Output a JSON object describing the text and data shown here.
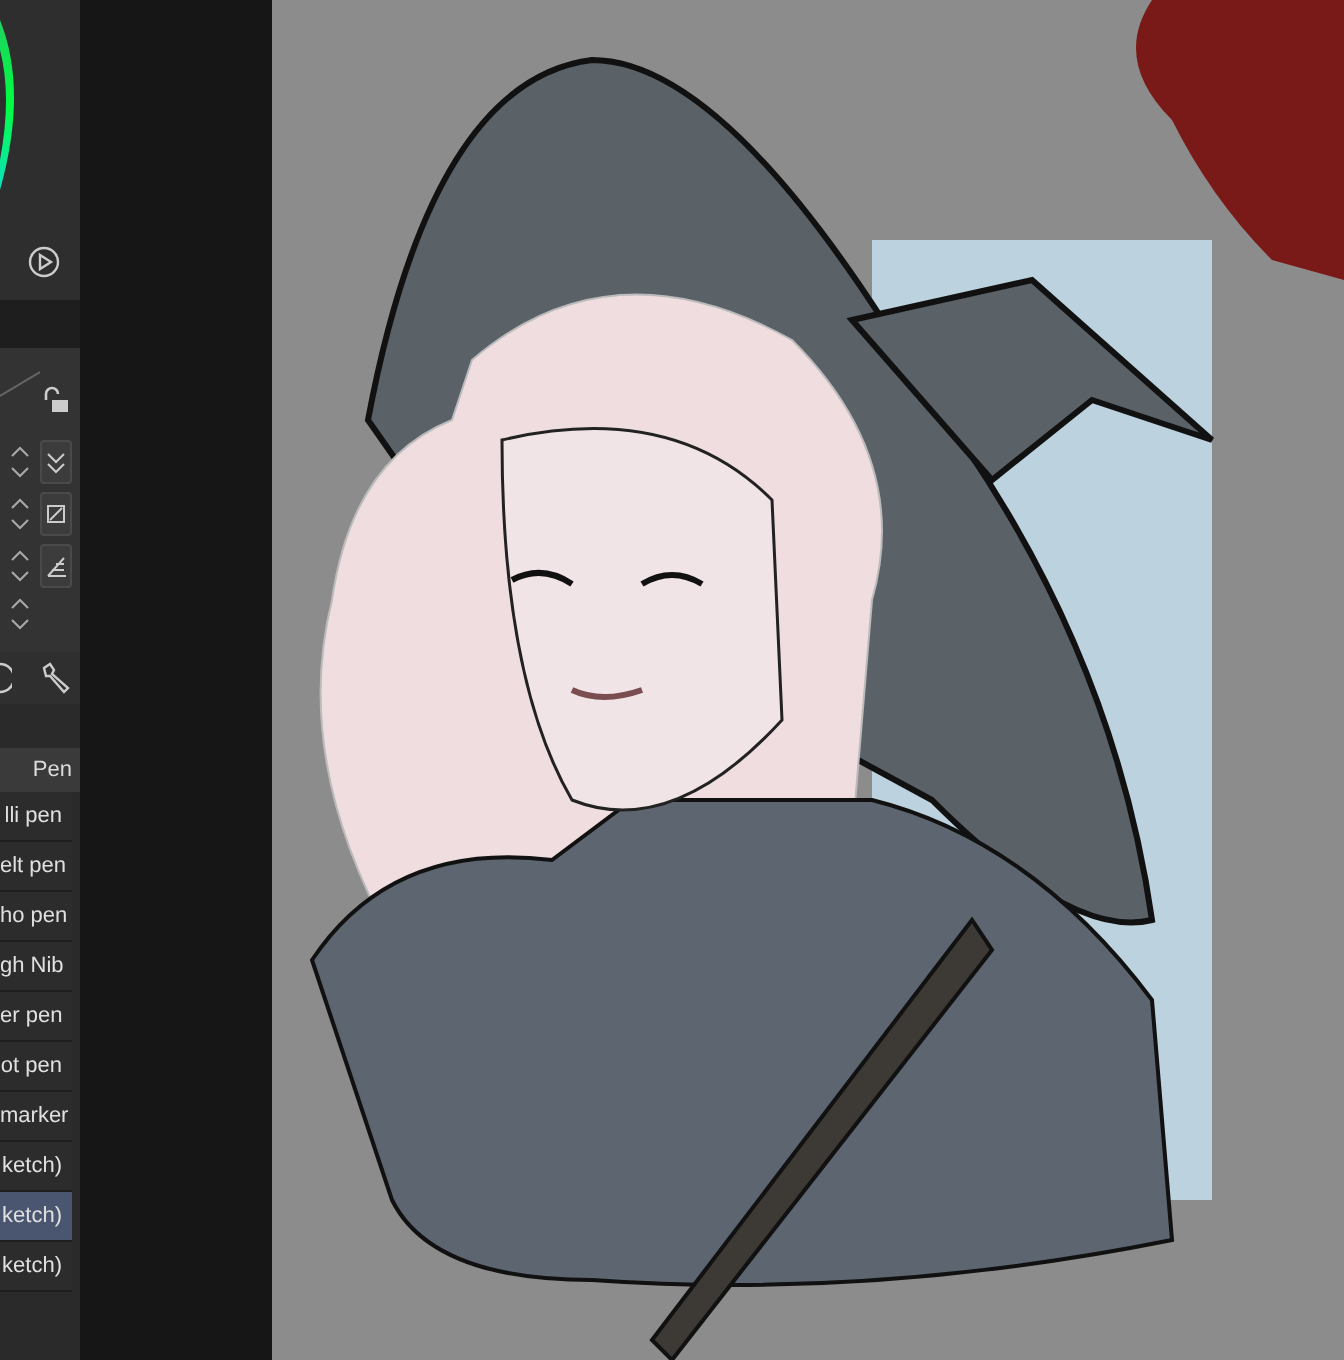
{
  "brush_panel": {
    "tab": "Pen",
    "brushes": [
      {
        "label": "lli pen",
        "selected": false
      },
      {
        "label": "elt pen",
        "selected": false
      },
      {
        "label": "ho pen",
        "selected": false
      },
      {
        "label": "gh Nib",
        "selected": false
      },
      {
        "label": "er pen",
        "selected": false
      },
      {
        "label": "ot pen",
        "selected": false
      },
      {
        "label": "marker",
        "selected": false
      },
      {
        "label": "ketch)",
        "selected": false
      },
      {
        "label": "ketch)",
        "selected": true
      },
      {
        "label": "ketch)",
        "selected": false
      }
    ]
  }
}
